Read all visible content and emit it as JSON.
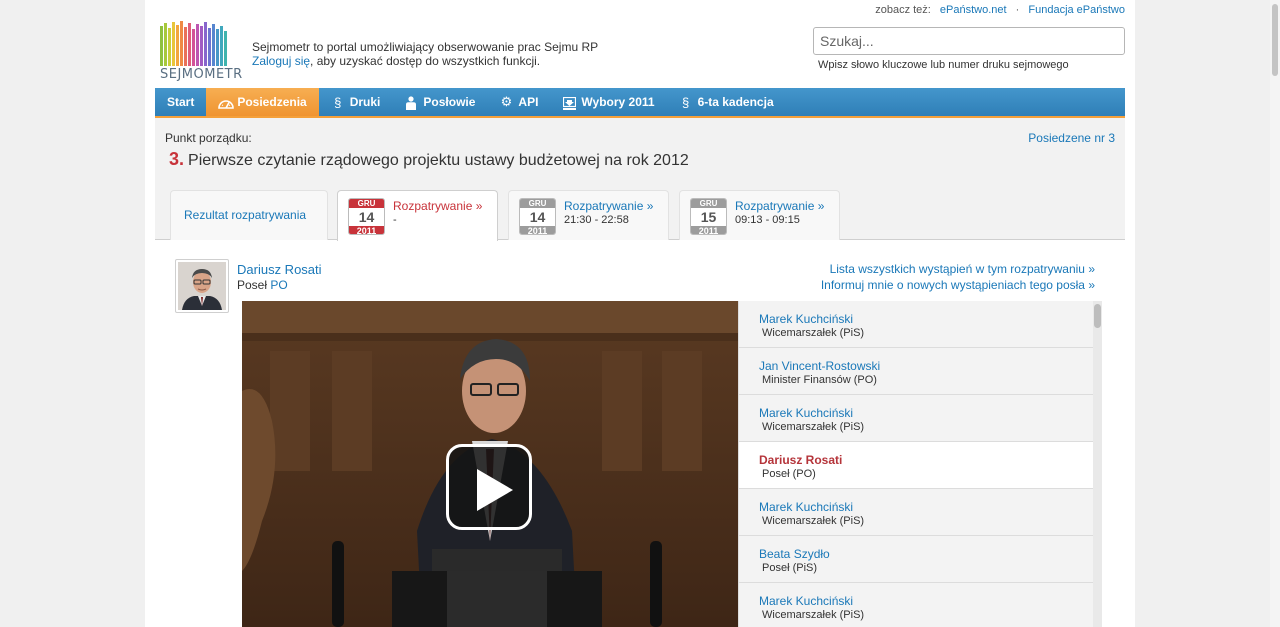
{
  "header": {
    "logo_text": "SEJMOMETR",
    "tagline_line1": "Sejmometr to portal umożliwiający obserwowanie prac Sejmu RP",
    "login_link": "Zaloguj się",
    "tagline_line2_rest": ", aby uzyskać dostęp do wszystkich funkcji.",
    "see_also_label": "zobacz też:",
    "see_also_links": [
      "ePaństwo.net",
      "Fundacja ePaństwo"
    ],
    "see_also_separator": "·",
    "search_placeholder": "Szukaj...",
    "search_hint": "Wpisz słowo kluczowe lub numer druku sejmowego"
  },
  "nav": [
    {
      "label": "Start",
      "icon": "none",
      "active": false
    },
    {
      "label": "Posiedzenia",
      "icon": "gauge-icon",
      "active": true
    },
    {
      "label": "Druki",
      "icon": "paragraph-icon",
      "active": false
    },
    {
      "label": "Posłowie",
      "icon": "person-icon",
      "active": false
    },
    {
      "label": "API",
      "icon": "gear-icon",
      "active": false
    },
    {
      "label": "Wybory 2011",
      "icon": "download-icon",
      "active": false
    },
    {
      "label": "6-ta kadencja",
      "icon": "paragraph-icon",
      "active": false
    }
  ],
  "agenda": {
    "label": "Punkt porządku:",
    "number": "3.",
    "title": "Pierwsze czytanie rządowego projektu ustawy budżetowej na rok 2012",
    "sitting_link": "Posiedzene nr 3"
  },
  "tabs": {
    "result_label": "Rezultat rozpatrywania",
    "items": [
      {
        "month": "GRU",
        "day": "14",
        "year": "2011",
        "title": "Rozpatrywanie »",
        "time": "-",
        "active": true
      },
      {
        "month": "GRU",
        "day": "14",
        "year": "2011",
        "title": "Rozpatrywanie »",
        "time": "21:30 - 22:58",
        "active": false
      },
      {
        "month": "GRU",
        "day": "15",
        "year": "2011",
        "title": "Rozpatrywanie »",
        "time": "09:13 - 09:15",
        "active": false
      }
    ]
  },
  "speaker": {
    "name": "Dariusz Rosati",
    "role": "Poseł",
    "party": "PO",
    "link_all": "Lista wszystkich wystąpień w tym rozpatrywaniu »",
    "link_notify": "Informuj mnie o nowych wystąpieniach tego posła »"
  },
  "speakers_list": [
    {
      "name": "Marek Kuchciński",
      "role": "Wicemarszałek (PiS)",
      "current": false
    },
    {
      "name": "Jan Vincent-Rostowski",
      "role": "Minister Finansów (PO)",
      "current": false
    },
    {
      "name": "Marek Kuchciński",
      "role": "Wicemarszałek (PiS)",
      "current": false
    },
    {
      "name": "Dariusz Rosati",
      "role": "Poseł (PO)",
      "current": true
    },
    {
      "name": "Marek Kuchciński",
      "role": "Wicemarszałek (PiS)",
      "current": false
    },
    {
      "name": "Beata Szydło",
      "role": "Poseł (PiS)",
      "current": false
    },
    {
      "name": "Marek Kuchciński",
      "role": "Wicemarszałek (PiS)",
      "current": false
    }
  ],
  "colors": {
    "link": "#1a78b8",
    "nav_blue": "#2f7fb7",
    "nav_active": "#f39b37",
    "accent_red": "#c8333a"
  }
}
